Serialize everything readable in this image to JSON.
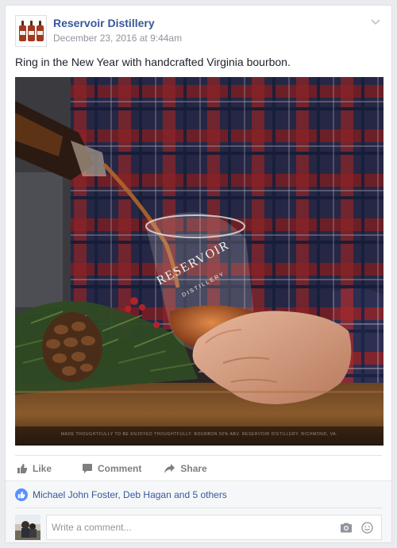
{
  "post": {
    "page_name": "Reservoir Distillery",
    "date": "December 23, 2016 at 9:44am",
    "text": "Ring in the New Year with handcrafted Virginia bourbon.",
    "photo": {
      "glass_brand": "RESERVOIR",
      "glass_sub": "DISTILLERY",
      "caption": "MADE THOUGHTFULLY TO BE ENJOYED THOUGHTFULLY. BOURBON 50% ABV. RESERVOIR DISTILLERY. RICHMOND, VA."
    }
  },
  "actions": {
    "like": "Like",
    "comment": "Comment",
    "share": "Share"
  },
  "likes": {
    "summary": "Michael John Foster, Deb Hagan and 5 others"
  },
  "comment_input": {
    "placeholder": "Write a comment..."
  },
  "colors": {
    "link": "#365899",
    "like_blue": "#5890ff",
    "background": "#e9ebee"
  },
  "icons": [
    "chevron-down-icon",
    "like-icon",
    "comment-icon",
    "share-icon",
    "camera-icon",
    "smile-icon"
  ]
}
